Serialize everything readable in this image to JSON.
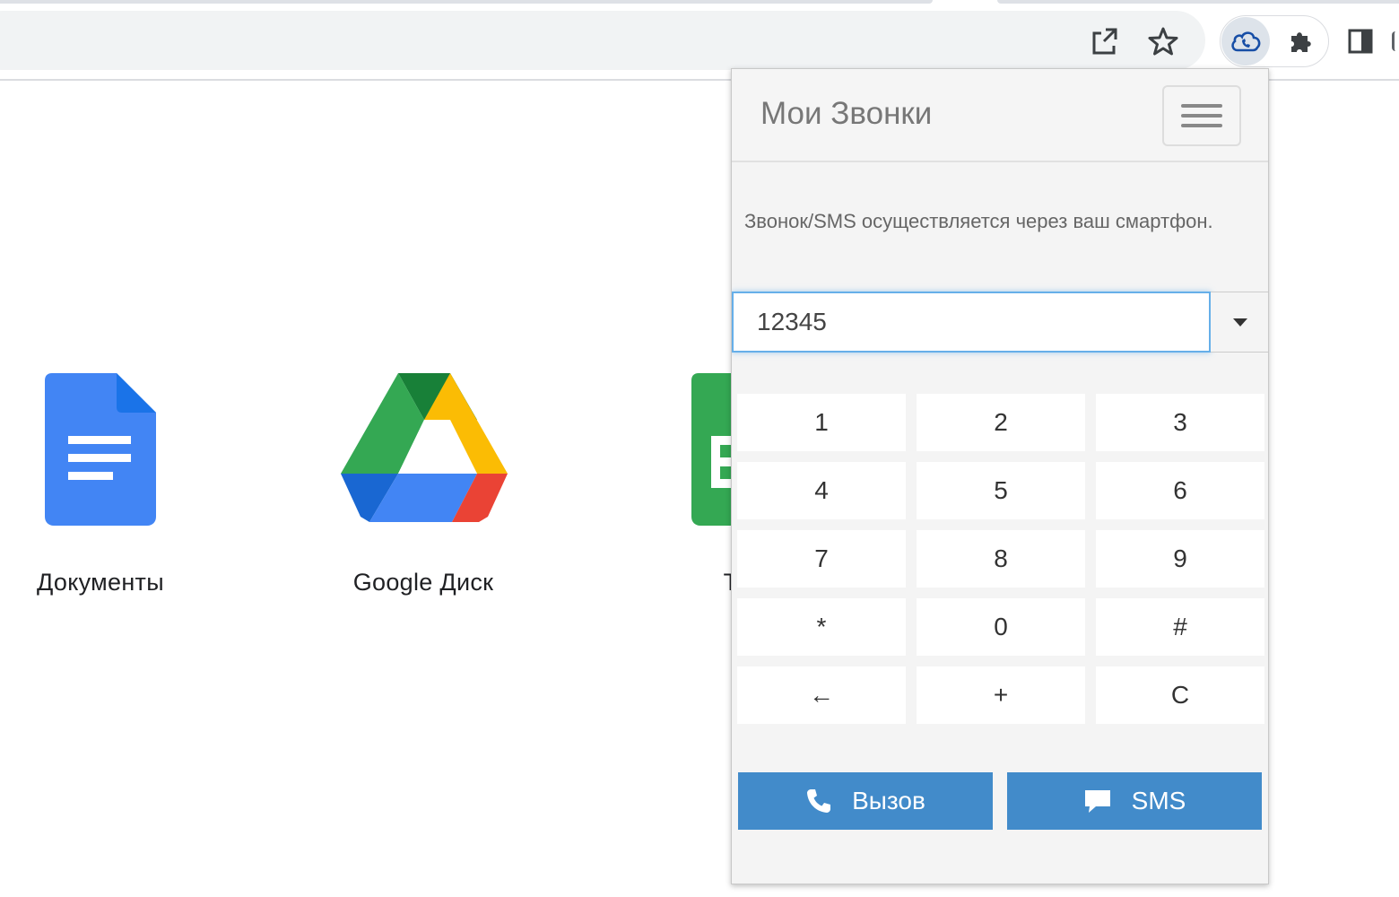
{
  "browser": {
    "icons": [
      "share-icon",
      "star-icon",
      "cloud-phone-icon",
      "puzzle-icon",
      "side-panel-icon"
    ]
  },
  "shortcuts": [
    {
      "label": "Документы",
      "icon": "google-docs-icon"
    },
    {
      "label": "Google Диск",
      "icon": "google-drive-icon"
    },
    {
      "label": "Таб",
      "icon": "google-sheets-icon"
    }
  ],
  "popup": {
    "title": "Мои Звонки",
    "info": "Звонок/SMS осуществляется через ваш смартфон.",
    "number_value": "12345",
    "keys": [
      "1",
      "2",
      "3",
      "4",
      "5",
      "6",
      "7",
      "8",
      "9",
      "*",
      "0",
      "#",
      "←",
      "+",
      "C"
    ],
    "call_label": "Вызов",
    "sms_label": "SMS",
    "colors": {
      "accent": "#428bca",
      "focus": "#66afe9",
      "title": "#777777"
    }
  }
}
